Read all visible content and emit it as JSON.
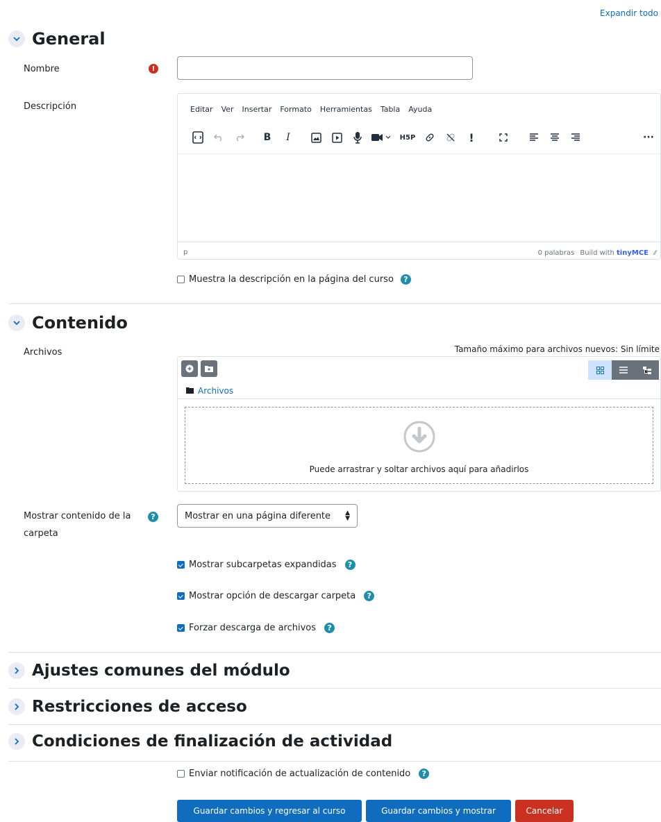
{
  "header": {
    "expand_all": "Expandir todo"
  },
  "sections": {
    "general": "General",
    "content": "Contenido",
    "common": "Ajustes comunes del módulo",
    "restrictions": "Restricciones de acceso",
    "completion": "Condiciones de finalización de actividad"
  },
  "general": {
    "name_label": "Nombre",
    "name_value": "",
    "description_label": "Descripción",
    "editor": {
      "menu": [
        "Editar",
        "Ver",
        "Insertar",
        "Formato",
        "Herramientas",
        "Tabla",
        "Ayuda"
      ],
      "status_path": "p",
      "word_count": "0 palabras",
      "build_with": "Build with",
      "brand": "tinyMCE"
    },
    "show_description": "Muestra la descripción en la página del curso"
  },
  "content": {
    "files_label": "Archivos",
    "max_size": "Tamaño máximo para archivos nuevos: Sin límite",
    "folder_path": "Archivos",
    "drop_text": "Puede arrastrar y soltar archivos aquí para añadirlos",
    "display_label_line1": "Mostrar contenido de la",
    "display_label_line2": "carpeta",
    "display_select": "Mostrar en una página diferente",
    "show_expanded": "Mostrar subcarpetas expandidas",
    "show_download": "Mostrar opción de descargar carpeta",
    "force_download": "Forzar descarga de archivos"
  },
  "footer": {
    "notify": "Enviar notificación de actualización de contenido",
    "save_return": "Guardar cambios y regresar al curso",
    "save_display": "Guardar cambios y mostrar",
    "cancel": "Cancelar"
  },
  "colors": {
    "primary": "#0f6cbf",
    "danger": "#ca3120",
    "help": "#1f8ea8"
  }
}
